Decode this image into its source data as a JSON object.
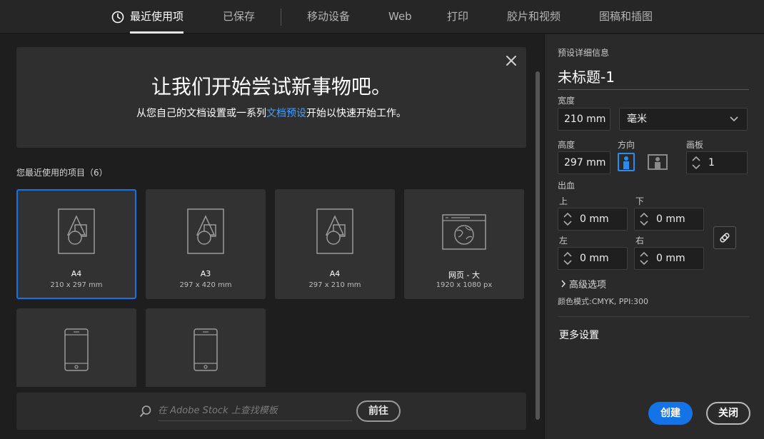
{
  "tabs": [
    {
      "label": "最近使用项",
      "active": true
    },
    {
      "label": "已保存"
    },
    {
      "label": "移动设备"
    },
    {
      "label": "Web"
    },
    {
      "label": "打印"
    },
    {
      "label": "胶片和视频"
    },
    {
      "label": "图稿和插图"
    }
  ],
  "hero": {
    "title": "让我们开始尝试新事物吧。",
    "sub_before": "从您自己的文档设置或一系列",
    "sub_link": "文档预设",
    "sub_after": "开始以快速开始工作。"
  },
  "recent": {
    "title": "您最近使用的项目（6）",
    "items": [
      {
        "name": "A4",
        "size": "210 x 297 mm",
        "icon": "document-shapes-icon",
        "selected": true
      },
      {
        "name": "A3",
        "size": "297 x 420 mm",
        "icon": "document-shapes-icon"
      },
      {
        "name": "A4",
        "size": "297 x 210 mm",
        "icon": "document-shapes-icon"
      },
      {
        "name": "网页 - 大",
        "size": "1920 x 1080 px",
        "icon": "web-globe-icon"
      },
      {
        "name": "",
        "size": "",
        "icon": "phone-icon"
      },
      {
        "name": "",
        "size": "",
        "icon": "phone-icon"
      }
    ]
  },
  "search": {
    "placeholder": "在 Adobe Stock 上查找模板",
    "go_label": "前往"
  },
  "details": {
    "heading": "预设详细信息",
    "doc_name": "未标题-1",
    "width_label": "宽度",
    "width_value": "210 mm",
    "unit": "毫米",
    "height_label": "高度",
    "height_value": "297 mm",
    "orientation_label": "方向",
    "artboard_label": "画板",
    "artboard_value": "1",
    "bleed_label": "出血",
    "top_label": "上",
    "top_value": "0 mm",
    "bottom_label": "下",
    "bottom_value": "0 mm",
    "left_label": "左",
    "left_value": "0 mm",
    "right_label": "右",
    "right_value": "0 mm",
    "advanced_label": "高级选项",
    "color_mode": "颜色模式:CMYK, PPI:300",
    "more_settings": "更多设置",
    "create_label": "创建",
    "close_label": "关闭"
  },
  "colors": {
    "accent": "#1473e6",
    "link": "#4b9cf5"
  }
}
